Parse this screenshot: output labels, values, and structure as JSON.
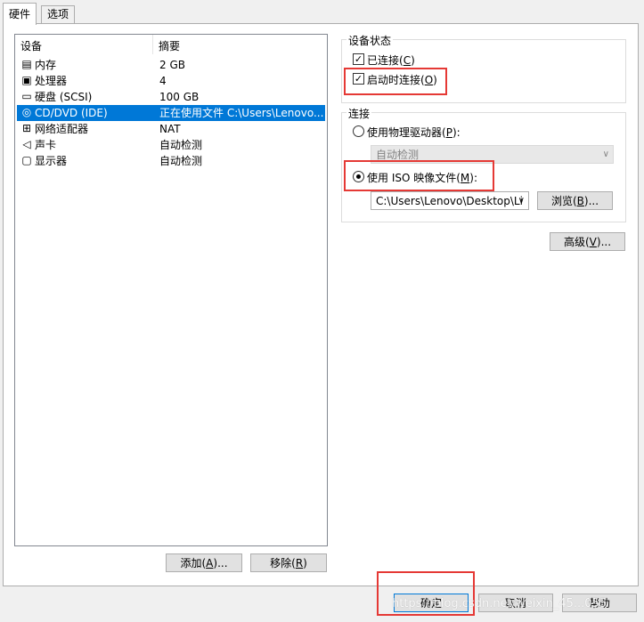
{
  "tabs": [
    {
      "label": "硬件"
    },
    {
      "label": "选项"
    }
  ],
  "device_list": {
    "columns": [
      "设备",
      "摘要"
    ],
    "rows": [
      {
        "icon": "memory-icon",
        "name": "内存",
        "summary": "2 GB"
      },
      {
        "icon": "processor-icon",
        "name": "处理器",
        "summary": "4"
      },
      {
        "icon": "hard-disk-icon",
        "name": "硬盘 (SCSI)",
        "summary": "100 GB"
      },
      {
        "icon": "cd-dvd-icon",
        "name": "CD/DVD (IDE)",
        "summary": "正在使用文件 C:\\Users\\Lenovo...",
        "selected": true
      },
      {
        "icon": "network-adapter-icon",
        "name": "网络适配器",
        "summary": "NAT"
      },
      {
        "icon": "sound-card-icon",
        "name": "声卡",
        "summary": "自动检测"
      },
      {
        "icon": "display-icon",
        "name": "显示器",
        "summary": "自动检测"
      }
    ]
  },
  "list_buttons": {
    "add": {
      "text": "添加",
      "mnemonic": "A",
      "suffix": ")..."
    },
    "remove": {
      "text": "移除",
      "mnemonic": "R",
      "suffix": ")"
    }
  },
  "device_status": {
    "title": "设备状态",
    "connected": {
      "label": "已连接",
      "mnemonic": "C",
      "checked": true
    },
    "connect_at_power_on": {
      "label": "启动时连接",
      "mnemonic": "O",
      "checked": true
    }
  },
  "connection": {
    "title": "连接",
    "physical_drive": {
      "label": "使用物理驱动器",
      "mnemonic": "P",
      "selected": false
    },
    "physical_drive_value": "自动检测",
    "iso_image": {
      "label": "使用 ISO 映像文件",
      "mnemonic": "M",
      "selected": true
    },
    "iso_path": "C:\\Users\\Lenovo\\Desktop\\Li",
    "browse": {
      "text": "浏览",
      "mnemonic": "B",
      "suffix": ")..."
    }
  },
  "advanced": {
    "text": "高级",
    "mnemonic": "V",
    "suffix": ")..."
  },
  "footer": {
    "ok": "确定",
    "cancel": "取消",
    "help": "帮助"
  },
  "watermark": "https://blog.csdn.net/weixin_45...055",
  "highlight_color": "#e53935",
  "selection_color": "#0078d7"
}
